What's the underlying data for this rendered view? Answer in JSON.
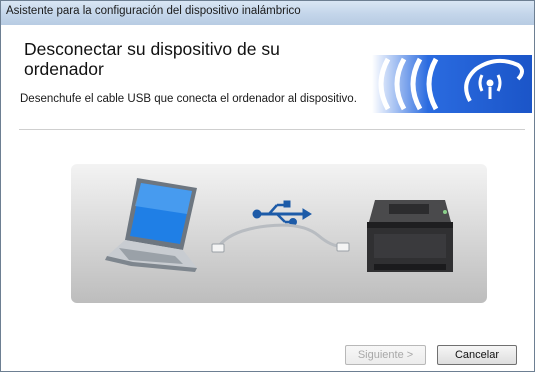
{
  "window": {
    "title": "Asistente para la configuración del dispositivo inalámbrico"
  },
  "header": {
    "heading": "Desconectar su dispositivo de su ordenador"
  },
  "main": {
    "instruction": "Desenchufe el cable USB que conecta el ordenador al dispositivo."
  },
  "buttons": {
    "next": "Siguiente >",
    "cancel": "Cancelar"
  },
  "colors": {
    "brand_blue": "#2f6fe0",
    "header_logo_blue": "#1f5fd6"
  }
}
